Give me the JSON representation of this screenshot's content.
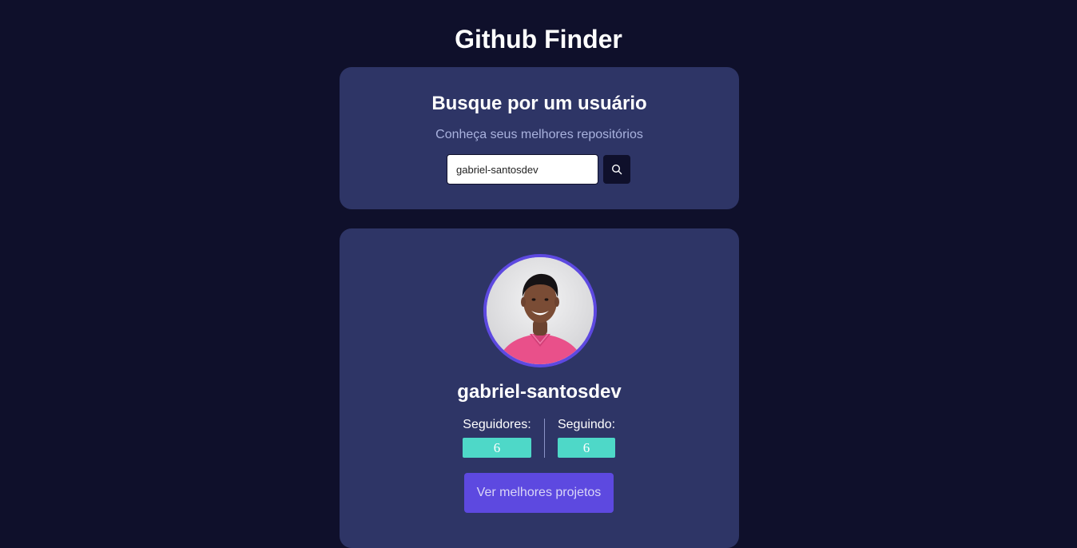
{
  "app": {
    "title": "Github Finder"
  },
  "search": {
    "heading": "Busque por um usuário",
    "subtitle": "Conheça seus melhores repositórios",
    "input_value": "gabriel-santosdev",
    "button_icon": "search-icon"
  },
  "profile": {
    "avatar": "profile-photo",
    "username": "gabriel-santosdev",
    "followers_label": "Seguidores:",
    "followers_count": "6",
    "following_label": "Seguindo:",
    "following_count": "6",
    "projects_button": "Ver melhores projetos"
  },
  "colors": {
    "background": "#0f102b",
    "card": "#2e3566",
    "accent": "#5d49e0",
    "badge": "#4ed8c8"
  }
}
